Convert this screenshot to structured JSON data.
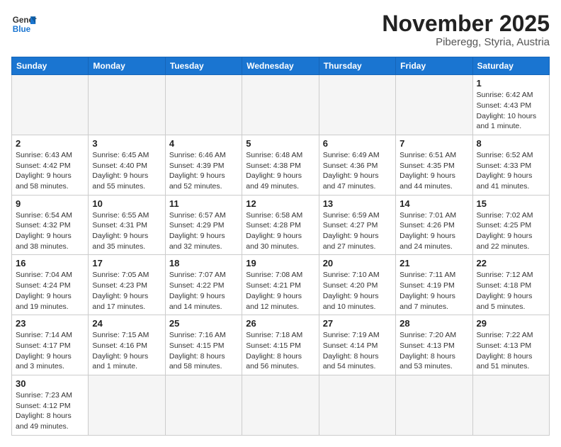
{
  "logo": {
    "text_general": "General",
    "text_blue": "Blue"
  },
  "title": "November 2025",
  "location": "Piberegg, Styria, Austria",
  "days_of_week": [
    "Sunday",
    "Monday",
    "Tuesday",
    "Wednesday",
    "Thursday",
    "Friday",
    "Saturday"
  ],
  "weeks": [
    [
      {
        "day": "",
        "info": ""
      },
      {
        "day": "",
        "info": ""
      },
      {
        "day": "",
        "info": ""
      },
      {
        "day": "",
        "info": ""
      },
      {
        "day": "",
        "info": ""
      },
      {
        "day": "",
        "info": ""
      },
      {
        "day": "1",
        "info": "Sunrise: 6:42 AM\nSunset: 4:43 PM\nDaylight: 10 hours and 1 minute."
      }
    ],
    [
      {
        "day": "2",
        "info": "Sunrise: 6:43 AM\nSunset: 4:42 PM\nDaylight: 9 hours and 58 minutes."
      },
      {
        "day": "3",
        "info": "Sunrise: 6:45 AM\nSunset: 4:40 PM\nDaylight: 9 hours and 55 minutes."
      },
      {
        "day": "4",
        "info": "Sunrise: 6:46 AM\nSunset: 4:39 PM\nDaylight: 9 hours and 52 minutes."
      },
      {
        "day": "5",
        "info": "Sunrise: 6:48 AM\nSunset: 4:38 PM\nDaylight: 9 hours and 49 minutes."
      },
      {
        "day": "6",
        "info": "Sunrise: 6:49 AM\nSunset: 4:36 PM\nDaylight: 9 hours and 47 minutes."
      },
      {
        "day": "7",
        "info": "Sunrise: 6:51 AM\nSunset: 4:35 PM\nDaylight: 9 hours and 44 minutes."
      },
      {
        "day": "8",
        "info": "Sunrise: 6:52 AM\nSunset: 4:33 PM\nDaylight: 9 hours and 41 minutes."
      }
    ],
    [
      {
        "day": "9",
        "info": "Sunrise: 6:54 AM\nSunset: 4:32 PM\nDaylight: 9 hours and 38 minutes."
      },
      {
        "day": "10",
        "info": "Sunrise: 6:55 AM\nSunset: 4:31 PM\nDaylight: 9 hours and 35 minutes."
      },
      {
        "day": "11",
        "info": "Sunrise: 6:57 AM\nSunset: 4:29 PM\nDaylight: 9 hours and 32 minutes."
      },
      {
        "day": "12",
        "info": "Sunrise: 6:58 AM\nSunset: 4:28 PM\nDaylight: 9 hours and 30 minutes."
      },
      {
        "day": "13",
        "info": "Sunrise: 6:59 AM\nSunset: 4:27 PM\nDaylight: 9 hours and 27 minutes."
      },
      {
        "day": "14",
        "info": "Sunrise: 7:01 AM\nSunset: 4:26 PM\nDaylight: 9 hours and 24 minutes."
      },
      {
        "day": "15",
        "info": "Sunrise: 7:02 AM\nSunset: 4:25 PM\nDaylight: 9 hours and 22 minutes."
      }
    ],
    [
      {
        "day": "16",
        "info": "Sunrise: 7:04 AM\nSunset: 4:24 PM\nDaylight: 9 hours and 19 minutes."
      },
      {
        "day": "17",
        "info": "Sunrise: 7:05 AM\nSunset: 4:23 PM\nDaylight: 9 hours and 17 minutes."
      },
      {
        "day": "18",
        "info": "Sunrise: 7:07 AM\nSunset: 4:22 PM\nDaylight: 9 hours and 14 minutes."
      },
      {
        "day": "19",
        "info": "Sunrise: 7:08 AM\nSunset: 4:21 PM\nDaylight: 9 hours and 12 minutes."
      },
      {
        "day": "20",
        "info": "Sunrise: 7:10 AM\nSunset: 4:20 PM\nDaylight: 9 hours and 10 minutes."
      },
      {
        "day": "21",
        "info": "Sunrise: 7:11 AM\nSunset: 4:19 PM\nDaylight: 9 hours and 7 minutes."
      },
      {
        "day": "22",
        "info": "Sunrise: 7:12 AM\nSunset: 4:18 PM\nDaylight: 9 hours and 5 minutes."
      }
    ],
    [
      {
        "day": "23",
        "info": "Sunrise: 7:14 AM\nSunset: 4:17 PM\nDaylight: 9 hours and 3 minutes."
      },
      {
        "day": "24",
        "info": "Sunrise: 7:15 AM\nSunset: 4:16 PM\nDaylight: 9 hours and 1 minute."
      },
      {
        "day": "25",
        "info": "Sunrise: 7:16 AM\nSunset: 4:15 PM\nDaylight: 8 hours and 58 minutes."
      },
      {
        "day": "26",
        "info": "Sunrise: 7:18 AM\nSunset: 4:15 PM\nDaylight: 8 hours and 56 minutes."
      },
      {
        "day": "27",
        "info": "Sunrise: 7:19 AM\nSunset: 4:14 PM\nDaylight: 8 hours and 54 minutes."
      },
      {
        "day": "28",
        "info": "Sunrise: 7:20 AM\nSunset: 4:13 PM\nDaylight: 8 hours and 53 minutes."
      },
      {
        "day": "29",
        "info": "Sunrise: 7:22 AM\nSunset: 4:13 PM\nDaylight: 8 hours and 51 minutes."
      }
    ],
    [
      {
        "day": "30",
        "info": "Sunrise: 7:23 AM\nSunset: 4:12 PM\nDaylight: 8 hours and 49 minutes."
      },
      {
        "day": "",
        "info": ""
      },
      {
        "day": "",
        "info": ""
      },
      {
        "day": "",
        "info": ""
      },
      {
        "day": "",
        "info": ""
      },
      {
        "day": "",
        "info": ""
      },
      {
        "day": "",
        "info": ""
      }
    ]
  ]
}
